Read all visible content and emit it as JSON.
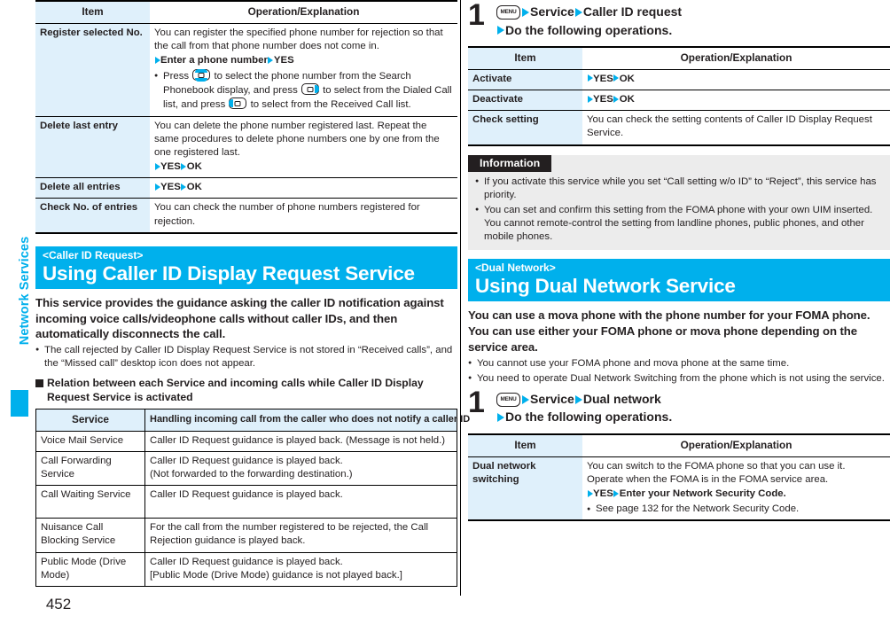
{
  "sidebar": {
    "chapter_label": "Network Services",
    "accent_color": "#00b0ec"
  },
  "page_number": "452",
  "left_column": {
    "rejection_table": {
      "headers": {
        "item": "Item",
        "operation": "Operation/Explanation"
      },
      "rows": [
        {
          "item": "Register selected No.",
          "lines": [
            "You can register the specified phone number for rejection so that the call from that phone number does not come in."
          ],
          "op_steps": [
            "Enter a phone number",
            "YES"
          ],
          "bullets_pre": "Press ",
          "bullet_mid_1": " to select the phone number from the Search Phonebook display, and press ",
          "bullet_mid_2": " to select from the Dialed Call list, and press ",
          "bullet_end": " to select from the Received Call list."
        },
        {
          "item": "Delete last entry",
          "lines": [
            "You can delete the phone number registered last. Repeat the same procedures to delete phone numbers one by one from the one registered last."
          ],
          "op_steps": [
            "YES",
            "OK"
          ]
        },
        {
          "item": "Delete all entries",
          "lines": [],
          "op_steps": [
            "YES",
            "OK"
          ]
        },
        {
          "item": "Check No. of entries",
          "lines": [
            "You can check the number of phone numbers registered for rejection."
          ],
          "op_steps": []
        }
      ]
    },
    "section": {
      "tagline": "<Caller ID Request>",
      "title": "Using Caller ID Display Request Service",
      "lead": "This service provides the guidance asking the caller ID notification against incoming voice calls/videophone calls without caller IDs, and then automatically disconnects the call.",
      "bullet": "The call rejected by Caller ID Display Request Service is not stored in “Received calls”, and the “Missed call” desktop icon does not appear.",
      "subhead": "Relation between each Service and incoming calls while Caller ID Display Request Service is activated"
    },
    "service_table": {
      "headers": {
        "service": "Service",
        "handling": "Handling incoming call from the caller who does not notify a caller ID"
      },
      "rows": [
        {
          "service": "Voice Mail Service",
          "handling": [
            "Caller ID Request guidance is played back. (Message is not held.)"
          ]
        },
        {
          "service": "Call Forwarding Service",
          "handling": [
            "Caller ID Request guidance is played back.",
            "(Not forwarded to the forwarding destination.)"
          ]
        },
        {
          "service": "Call Waiting Service",
          "handling": [
            "Caller ID Request guidance is played back."
          ]
        },
        {
          "service": "Nuisance Call Blocking Service",
          "handling": [
            "For the call from the number registered to be rejected, the Call Rejection guidance is played back."
          ]
        },
        {
          "service": "Public Mode (Drive Mode)",
          "handling": [
            "Caller ID Request guidance is played back.",
            "[Public Mode (Drive Mode) guidance is not played back.]"
          ]
        }
      ]
    }
  },
  "right_column": {
    "step_caller_id": {
      "number": "1",
      "key": "MENU",
      "line1_parts": [
        "Service",
        "Caller ID request"
      ],
      "line2": "Do the following operations."
    },
    "caller_id_table": {
      "headers": {
        "item": "Item",
        "operation": "Operation/Explanation"
      },
      "rows": [
        {
          "item": "Activate",
          "lines": [],
          "op_steps": [
            "YES",
            "OK"
          ]
        },
        {
          "item": "Deactivate",
          "lines": [],
          "op_steps": [
            "YES",
            "OK"
          ]
        },
        {
          "item": "Check setting",
          "lines": [
            "You can check the setting contents of Caller ID Display Request Service."
          ],
          "op_steps": []
        }
      ]
    },
    "information": {
      "tab_label": "Information",
      "bullets": [
        "If you activate this service while you set “Call setting w/o ID” to “Reject”, this service has priority.",
        "You can set and confirm this setting from the FOMA phone with your own UIM inserted. You cannot remote-control the setting from landline phones, public phones, and other mobile phones."
      ]
    },
    "section": {
      "tagline": "<Dual Network>",
      "title": "Using Dual Network Service",
      "lead": "You can use a mova phone with the phone number for your FOMA phone. You can use either your FOMA phone or mova phone depending on the service area.",
      "bullets": [
        "You cannot use your FOMA phone and mova phone at the same time.",
        "You need to operate Dual Network Switching from the phone which is not using the service."
      ]
    },
    "step_dual_network": {
      "number": "1",
      "key": "MENU",
      "line1_parts": [
        "Service",
        "Dual network"
      ],
      "line2": "Do the following operations."
    },
    "dual_network_table": {
      "headers": {
        "item": "Item",
        "operation": "Operation/Explanation"
      },
      "rows": [
        {
          "item": "Dual network switching",
          "lines": [
            "You can switch to the FOMA phone so that you can use it.",
            "Operate when the FOMA is in the FOMA service area."
          ],
          "op_steps": [
            "YES",
            "Enter your Network Security Code."
          ],
          "bullet": "See page 132 for the Network Security Code."
        }
      ]
    }
  }
}
